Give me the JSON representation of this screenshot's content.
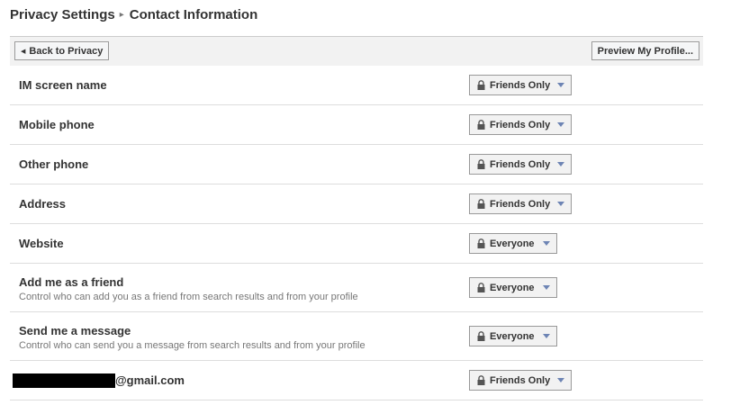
{
  "breadcrumb": {
    "parent": "Privacy Settings",
    "separator": "▸",
    "current": "Contact Information"
  },
  "toolbar": {
    "back_label": "Back to Privacy",
    "preview_label": "Preview My Profile..."
  },
  "icons": {
    "lock": "lock-icon",
    "dropdown": "triangle-down-icon"
  },
  "colors": {
    "accent": "#6d84b4",
    "toolbar_bg": "#f2f2f2",
    "divider": "#dddddd"
  },
  "settings": [
    {
      "label": "IM screen name",
      "description": "",
      "value": "Friends Only"
    },
    {
      "label": "Mobile phone",
      "description": "",
      "value": "Friends Only"
    },
    {
      "label": "Other phone",
      "description": "",
      "value": "Friends Only"
    },
    {
      "label": "Address",
      "description": "",
      "value": "Friends Only"
    },
    {
      "label": "Website",
      "description": "",
      "value": "Everyone"
    },
    {
      "label": "Add me as a friend",
      "description": "Control who can add you as a friend from search results and from your profile",
      "value": "Everyone"
    },
    {
      "label": "Send me a message",
      "description": "Control who can send you a message from search results and from your profile",
      "value": "Everyone"
    },
    {
      "label": "@gmail.com",
      "description": "",
      "value": "Friends Only"
    }
  ]
}
